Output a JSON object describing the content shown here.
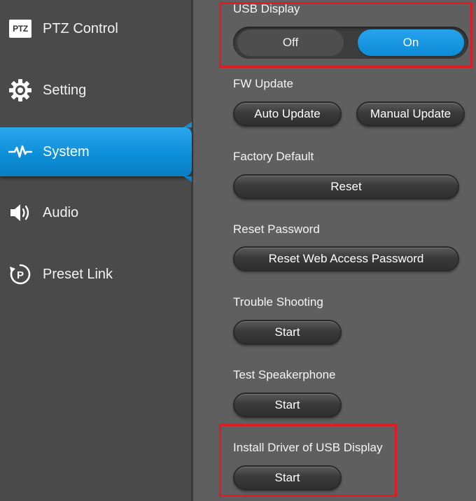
{
  "sidebar": {
    "items": [
      {
        "label": "PTZ Control",
        "icon": "ptz-badge-icon",
        "badge": "PTZ"
      },
      {
        "label": "Setting",
        "icon": "gear-icon"
      },
      {
        "label": "System",
        "icon": "pulse-icon",
        "active": true
      },
      {
        "label": "Audio",
        "icon": "speaker-icon"
      },
      {
        "label": "Preset Link",
        "icon": "preset-link-icon"
      }
    ]
  },
  "main": {
    "usb_display": {
      "label": "USB Display",
      "off_label": "Off",
      "on_label": "On",
      "selected": "On"
    },
    "fw_update": {
      "label": "FW Update",
      "auto_label": "Auto Update",
      "manual_label": "Manual Update"
    },
    "factory_default": {
      "label": "Factory Default",
      "button_label": "Reset"
    },
    "reset_password": {
      "label": "Reset Password",
      "button_label": "Reset Web Access Password"
    },
    "trouble_shooting": {
      "label": "Trouble Shooting",
      "button_label": "Start"
    },
    "test_speakerphone": {
      "label": "Test Speakerphone",
      "button_label": "Start"
    },
    "install_driver": {
      "label": "Install Driver of USB Display",
      "button_label": "Start"
    }
  },
  "colors": {
    "accent": "#0d8fd9",
    "sidebar_bg": "#4a4a4a",
    "content_bg": "#5f5f5f",
    "highlight": "#e01b24"
  }
}
